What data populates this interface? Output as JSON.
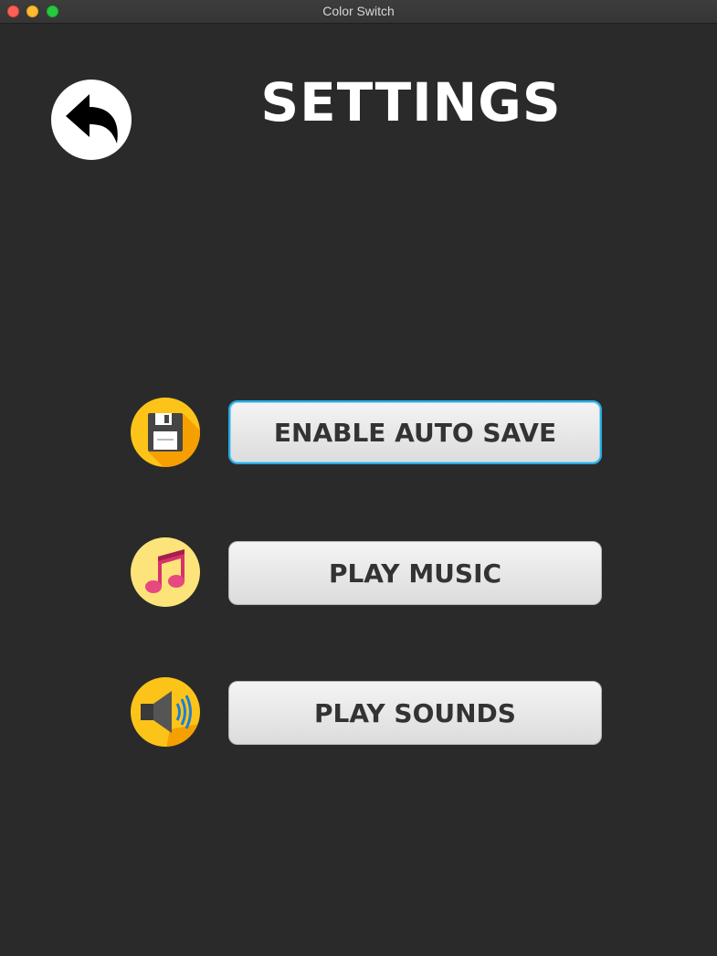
{
  "window": {
    "title": "Color Switch"
  },
  "header": {
    "title": "SETTINGS",
    "back_icon": "back-arrow-icon"
  },
  "settings": [
    {
      "id": "auto-save",
      "label": "ENABLE AUTO SAVE",
      "icon": "floppy-disk-icon",
      "focused": true
    },
    {
      "id": "music",
      "label": "PLAY MUSIC",
      "icon": "music-note-icon",
      "focused": false
    },
    {
      "id": "sounds",
      "label": "PLAY SOUNDS",
      "icon": "speaker-icon",
      "focused": false
    }
  ],
  "colors": {
    "background": "#2a2a2a",
    "button_text": "#333333",
    "focus_ring": "#2aa9e0",
    "icon_yellow": "#fcc419"
  }
}
